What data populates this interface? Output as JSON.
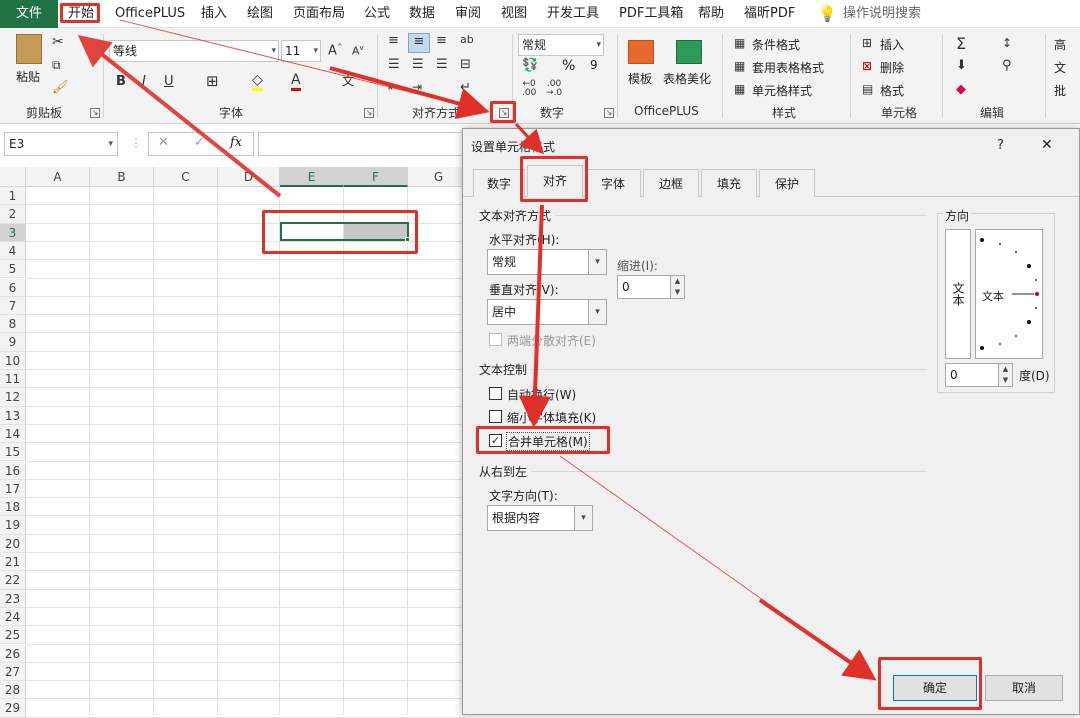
{
  "menu": {
    "file": "文件",
    "tabs": [
      "开始",
      "OfficePLUS",
      "插入",
      "绘图",
      "页面布局",
      "公式",
      "数据",
      "审阅",
      "视图",
      "开发工具",
      "PDF工具箱",
      "帮助",
      "福昕PDF"
    ],
    "search_placeholder": "操作说明搜索"
  },
  "ribbon": {
    "clipboard": {
      "paste": "粘贴",
      "label": "剪贴板"
    },
    "font": {
      "name": "等线",
      "size": "11",
      "label": "字体"
    },
    "alignment": {
      "label": "对齐方式"
    },
    "number": {
      "format": "常规",
      "label": "数字",
      "percent": "%",
      "comma": "9"
    },
    "officeplus": {
      "template": "模板",
      "beautify": "表格美化",
      "label": "OfficePLUS"
    },
    "styles": {
      "conditional": "条件格式",
      "table": "套用表格格式",
      "cell": "单元格样式",
      "label": "样式"
    },
    "cells": {
      "insert": "插入",
      "delete": "删除",
      "format": "格式",
      "label": "单元格"
    },
    "editing": {
      "label": "编辑"
    },
    "extra": {
      "high": "高",
      "text": "文",
      "ext": "批"
    }
  },
  "formula": {
    "namebox": "E3",
    "fx": "fx"
  },
  "grid": {
    "columns": [
      "A",
      "B",
      "C",
      "D",
      "E",
      "F",
      "G"
    ],
    "rows": [
      "1",
      "2",
      "3",
      "4",
      "5",
      "6",
      "7",
      "8",
      "9",
      "10",
      "11",
      "12",
      "13",
      "14",
      "15",
      "16",
      "17",
      "18",
      "19",
      "20",
      "21",
      "22",
      "23",
      "24",
      "25",
      "26",
      "27",
      "28",
      "29"
    ],
    "selected_cell": "E3"
  },
  "dialog": {
    "title": "设置单元格格式",
    "help": "?",
    "close": "✕",
    "tabs": [
      "数字",
      "对齐",
      "字体",
      "边框",
      "填充",
      "保护"
    ],
    "active_tab": "对齐",
    "text_alignment": {
      "title": "文本对齐方式",
      "horizontal_label": "水平对齐(H):",
      "horizontal_value": "常规",
      "indent_label": "缩进(I):",
      "indent_value": "0",
      "vertical_label": "垂直对齐(V):",
      "vertical_value": "居中",
      "distributed_label": "两端分散对齐(E)"
    },
    "text_control": {
      "title": "文本控制",
      "wrap": "自动换行(W)",
      "shrink": "缩小字体填充(K)",
      "merge": "合并单元格(M)",
      "merge_checked": true
    },
    "rtl": {
      "title": "从右到左",
      "direction_label": "文字方向(T):",
      "direction_value": "根据内容"
    },
    "orientation": {
      "title": "方向",
      "vertical_text": "文本",
      "angle_text": "文本",
      "degree_value": "0",
      "degree_label": "度(D)"
    },
    "ok": "确定",
    "cancel": "取消"
  },
  "colors": {
    "excel_green": "#217346",
    "annotation_red": "#e0302a"
  }
}
